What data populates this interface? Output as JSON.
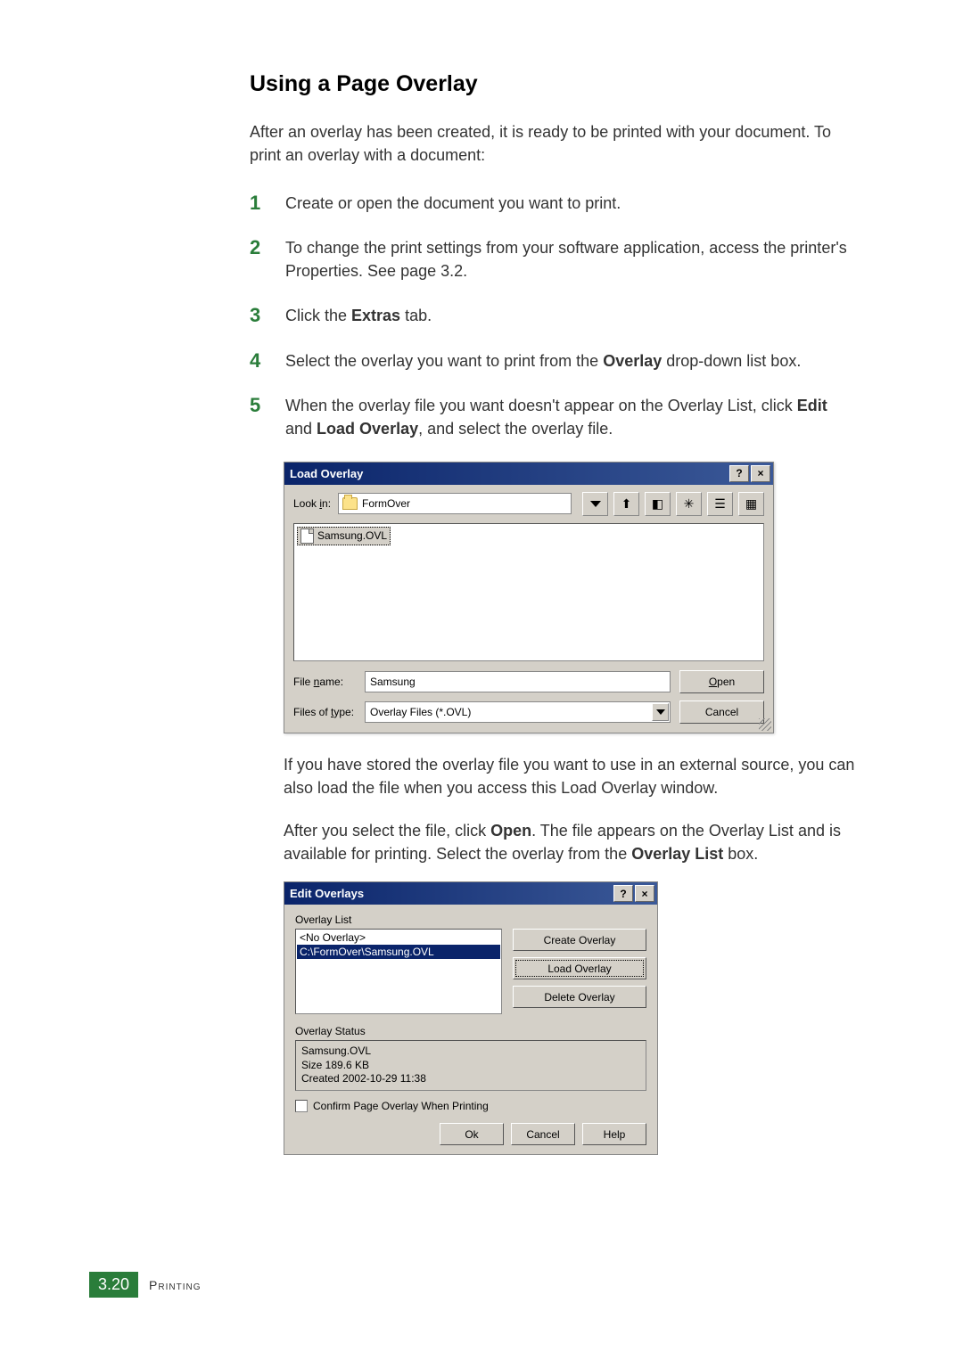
{
  "heading": "Using a Page Overlay",
  "intro": "After an overlay has been created, it is ready to be printed with your document. To print an overlay with a document:",
  "steps": {
    "s1": {
      "num": "1",
      "text": "Create or open the document you want to print."
    },
    "s2": {
      "num": "2",
      "text": "To change the print settings from your software application, access the printer's Properties. See page 3.2."
    },
    "s3": {
      "num": "3",
      "prefix": "Click the ",
      "bold": "Extras",
      "suffix": " tab."
    },
    "s4": {
      "num": "4",
      "prefix": "Select the overlay you want to print from the ",
      "bold": "Overlay",
      "suffix": " drop-down list box."
    },
    "s5": {
      "num": "5",
      "prefix": "When the overlay file you want doesn't appear on the Overlay List, click ",
      "bold1": "Edit",
      "mid": " and ",
      "bold2": "Load Overlay",
      "suffix": ", and select the overlay file."
    }
  },
  "load_dialog": {
    "title": "Load Overlay",
    "help_btn": "?",
    "close_btn": "×",
    "look_in_label_pre": "Look ",
    "look_in_label_u": "i",
    "look_in_label_post": "n:",
    "look_in_value": "FormOver",
    "file_item": "Samsung.OVL",
    "file_name_label_pre": "File ",
    "file_name_label_u": "n",
    "file_name_label_post": "ame:",
    "file_name_value": "Samsung",
    "files_of_type_label_pre": "Files of ",
    "files_of_type_label_u": "t",
    "files_of_type_label_post": "ype:",
    "files_of_type_value": "Overlay Files (*.OVL)",
    "open_u": "O",
    "open_post": "pen",
    "cancel": "Cancel"
  },
  "post_dialog1": "If you have stored the overlay file you want to use in an external source, you can also load the file when you access this Load Overlay window.",
  "post_dialog2_pre": "After you select the file, click ",
  "post_dialog2_b1": "Open",
  "post_dialog2_mid": ". The file appears on the Overlay List and is available for printing. Select the overlay from the ",
  "post_dialog2_b2": "Overlay List",
  "post_dialog2_post": " box.",
  "edit_dialog": {
    "title": "Edit Overlays",
    "help_btn": "?",
    "close_btn": "×",
    "list_label": "Overlay List",
    "list_items": {
      "i0": "<No Overlay>",
      "i1": "C:\\FormOver\\Samsung.OVL"
    },
    "btn_create": "Create Overlay",
    "btn_load": "Load Overlay",
    "btn_delete": "Delete Overlay",
    "status_label": "Overlay Status",
    "status_line1": "Samsung.OVL",
    "status_line2": "Size 189.6 KB",
    "status_line3": "Created 2002-10-29 11:38",
    "confirm_label": "Confirm Page Overlay When Printing",
    "btn_ok": "Ok",
    "btn_cancel": "Cancel",
    "btn_help": "Help"
  },
  "footer": {
    "page": "3.20",
    "section": "Printing"
  }
}
